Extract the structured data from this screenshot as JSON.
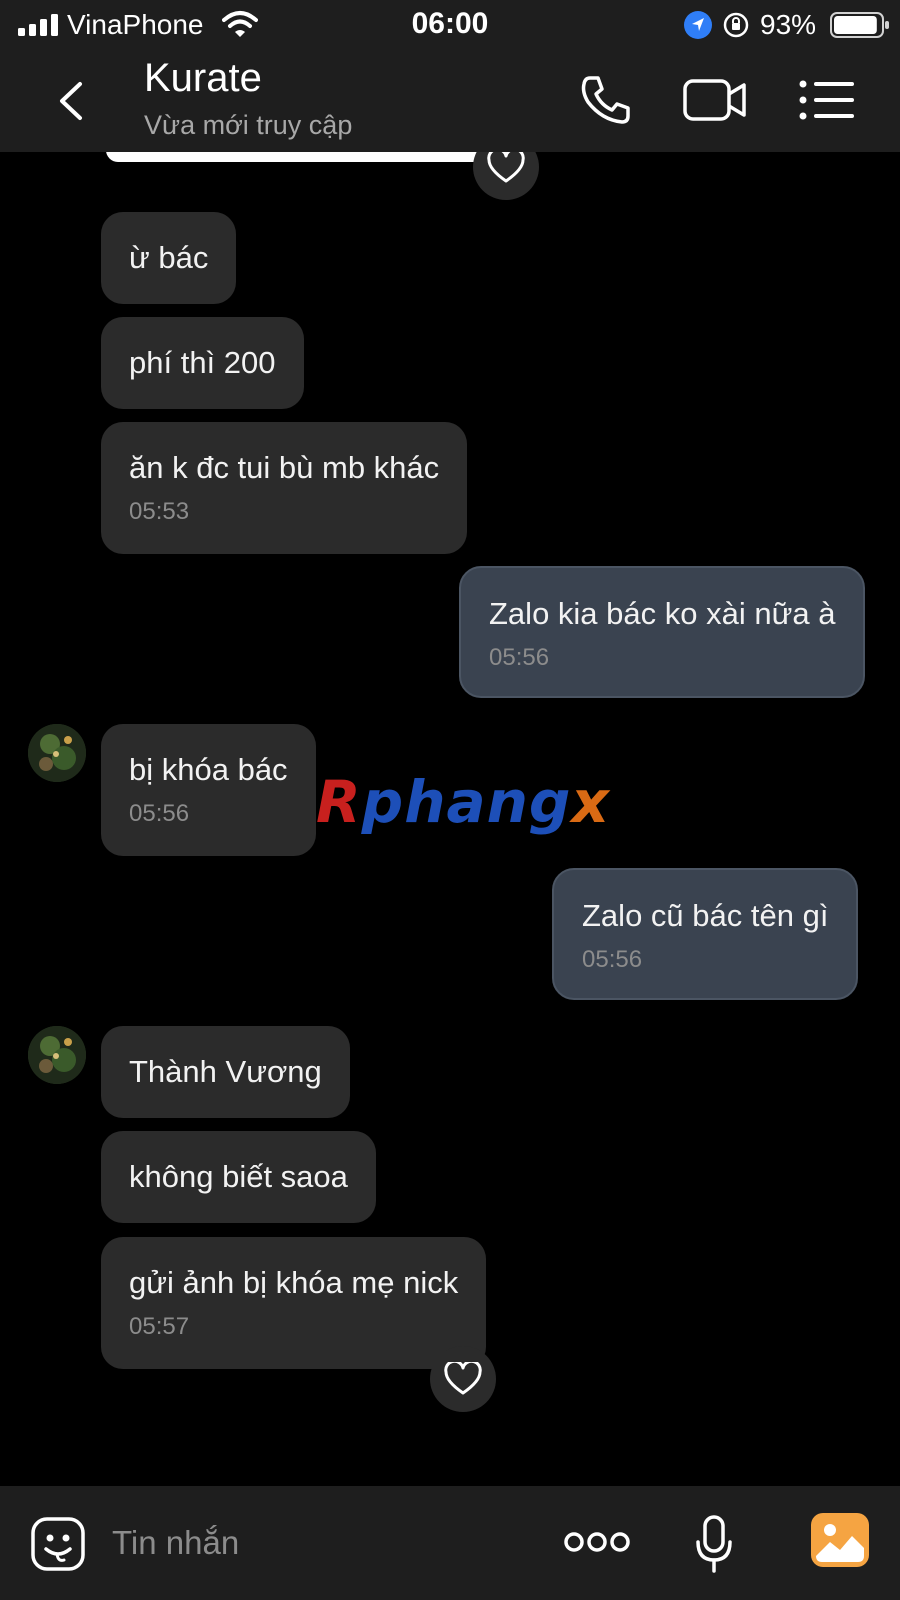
{
  "status_bar": {
    "carrier": "VinaPhone",
    "time": "06:00",
    "battery_percent": "93%",
    "battery_level": 0.93,
    "icons": [
      "signal-icon",
      "wifi-icon",
      "location-arrow-icon",
      "rotation-lock-icon",
      "battery-icon"
    ]
  },
  "header": {
    "contact_name": "Kurate",
    "status": "Vừa mới truy cập",
    "icons": [
      "back-chevron-icon",
      "phone-call-icon",
      "video-call-icon",
      "menu-list-icon"
    ]
  },
  "messages": [
    {
      "direction": "incoming",
      "text": "ừ bác"
    },
    {
      "direction": "incoming",
      "text": "phí thì 200"
    },
    {
      "direction": "incoming",
      "text": "ăn k đc tui bù mb khác",
      "time": "05:53"
    },
    {
      "direction": "outgoing",
      "text": "Zalo kia bác ko xài nữa à",
      "time": "05:56"
    },
    {
      "direction": "incoming",
      "text": "bị khóa bác",
      "time": "05:56"
    },
    {
      "direction": "outgoing",
      "text": "Zalo cũ bác tên gì",
      "time": "05:56"
    },
    {
      "direction": "incoming",
      "text": "Thành Vương"
    },
    {
      "direction": "incoming",
      "text": "không biết saoa"
    },
    {
      "direction": "incoming",
      "text": "gửi ảnh bị khóa mẹ nick",
      "time": "05:57"
    }
  ],
  "watermark": {
    "parts": [
      "R",
      "phang",
      "",
      "x"
    ],
    "colors": [
      "#c8201e",
      "#1d4fb8",
      "#2a8fd0",
      "#d96a14"
    ]
  },
  "input_bar": {
    "placeholder": "Tin nhắn",
    "icons": [
      "sticker-face-icon",
      "more-dots-icon",
      "microphone-icon",
      "gallery-image-icon"
    ],
    "gallery_color": "#f5a442"
  }
}
